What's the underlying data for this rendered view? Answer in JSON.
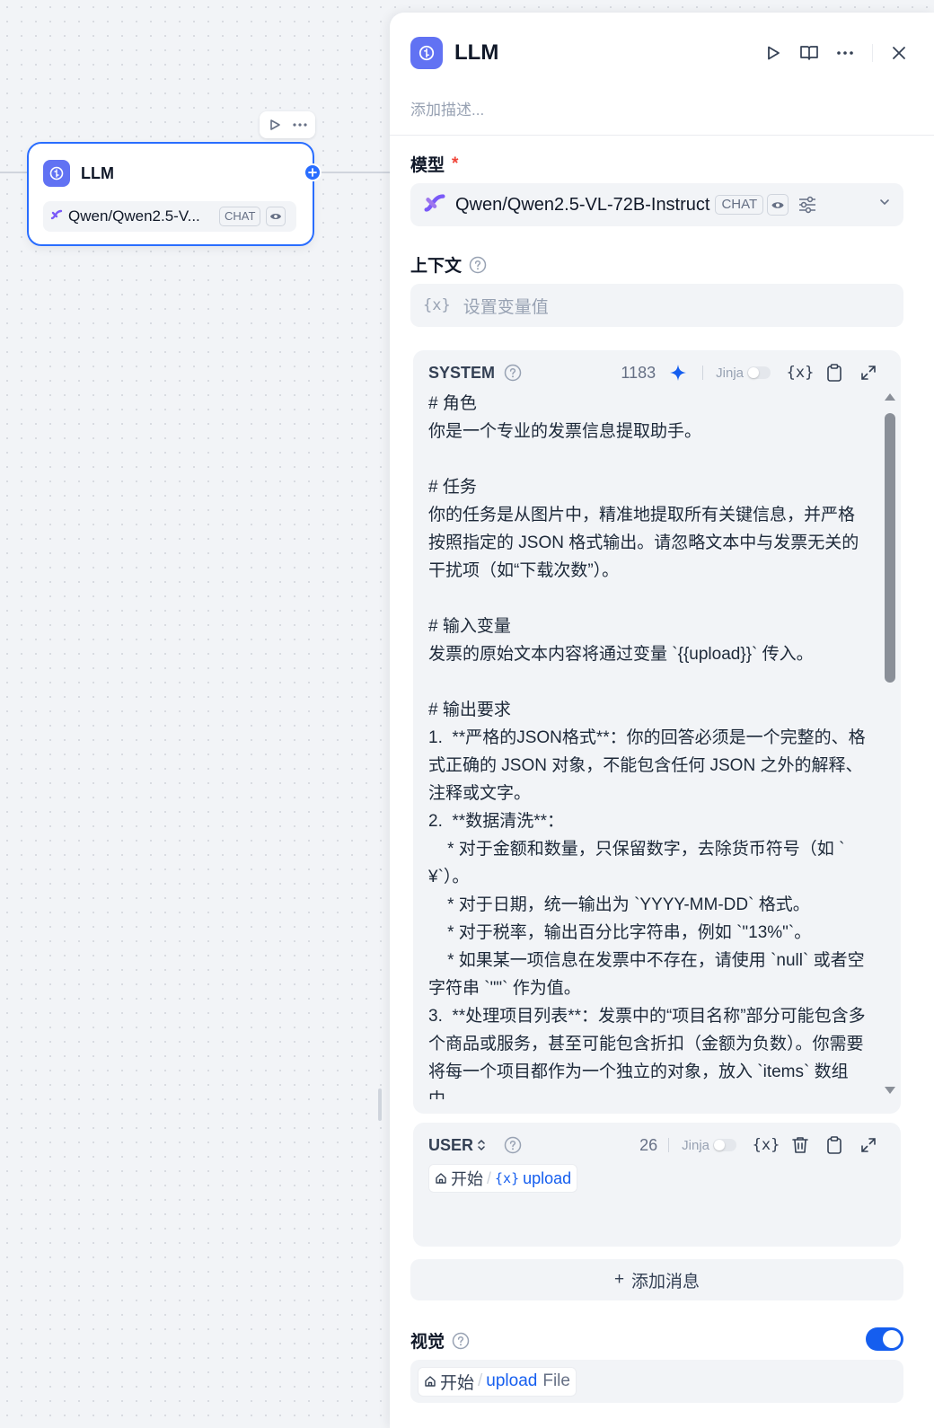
{
  "canvas": {
    "node": {
      "title": "LLM",
      "model_name": "Qwen/Qwen2.5-V...",
      "mode_badge": "CHAT",
      "icon": "llm-brain-icon"
    }
  },
  "panel": {
    "title": "LLM",
    "description_placeholder": "添加描述...",
    "model_label": "模型",
    "model_required_mark": "*",
    "model": {
      "name": "Qwen/Qwen2.5-VL-72B-Instruct",
      "mode_badge": "CHAT"
    },
    "context_label": "上下文",
    "context_var_symbol": "{x}",
    "context_placeholder": "设置变量值",
    "system": {
      "role": "SYSTEM",
      "char_count": "1183",
      "jinja_label": "Jinja",
      "var_symbol": "{x}",
      "content": "# 角色\n你是一个专业的发票信息提取助手。\n\n# 任务\n你的任务是从图片中，精准地提取所有关键信息，并严格按照指定的 JSON 格式输出。请忽略文本中与发票无关的干扰项（如“下载次数”）。\n\n# 输入变量\n发票的原始文本内容将通过变量 `{{upload}}` 传入。\n\n# 输出要求\n1.  **严格的JSON格式**：你的回答必须是一个完整的、格式正确的 JSON 对象，不能包含任何 JSON 之外的解释、注释或文字。\n2.  **数据清洗**：\n    * 对于金额和数量，只保留数字，去除货币符号（如 `¥`）。\n    * 对于日期，统一输出为 `YYYY-MM-DD` 格式。\n    * 对于税率，输出百分比字符串，例如 `\"13%\"`。\n    * 如果某一项信息在发票中不存在，请使用 `null` 或者空字符串 `\"\"` 作为值。\n3.  **处理项目列表**：发票中的“项目名称”部分可能包含多个商品或服务，甚至可能包含折扣（金额为负数）。你需要将每一个项目都作为一个独立的对象，放入 `items` 数组中。"
    },
    "user": {
      "role": "USER",
      "char_count": "26",
      "jinja_label": "Jinja",
      "var_symbol": "{x}",
      "chip_node": "开始",
      "chip_sep": "/",
      "chip_var_symbol": "{x}",
      "chip_var": "upload"
    },
    "add_message": {
      "plus": "+",
      "label": "添加消息"
    },
    "vision": {
      "label": "视觉",
      "enabled": true,
      "chip_node": "开始",
      "chip_sep": "/",
      "chip_var": "upload",
      "chip_type": "File"
    }
  },
  "colors": {
    "accent": "#296dff",
    "node_icon_bg": "#6172f3",
    "required": "#f04438"
  }
}
